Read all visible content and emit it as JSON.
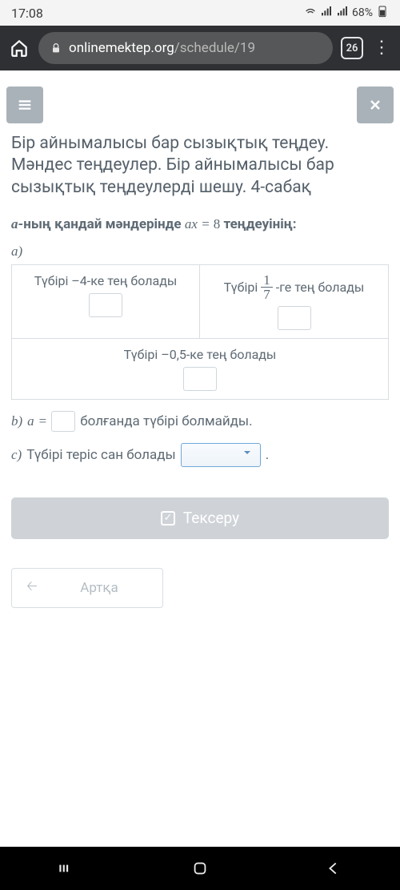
{
  "status": {
    "time": "17:08",
    "battery": "68%"
  },
  "browser": {
    "domain": "onlinemektep.org",
    "path": "/schedule/19",
    "tab_count": "26"
  },
  "lesson": {
    "title": "Бір айнымалысы бар сызықтық теңдеу. Мәндес теңдеулер. Бір айнымалысы бар сызықтық теңдеулерді шешу. 4-сабақ"
  },
  "question": {
    "prefix_italic": "a",
    "prefix_bold_rest": "-ның қандай мәндерінде",
    "equation_lhs": "ax",
    "equation_eq": "=",
    "equation_rhs": "8",
    "suffix": "теңдеуінің:"
  },
  "parts": {
    "a_label": "a)",
    "cell1": "Түбірі –4-ке тең болады",
    "cell2_pre": "Түбірі",
    "cell2_frac_num": "1",
    "cell2_frac_den": "7",
    "cell2_post": "-ге тең болады",
    "cell3": "Түбірі –0,5-ке тең болады",
    "b_label": "b)",
    "b_var": "a",
    "b_eq": "=",
    "b_text": "болғанда түбірі болмайды.",
    "c_label": "c)",
    "c_text": "Түбірі теріс сан болады",
    "c_period": "."
  },
  "buttons": {
    "check": "Тексеру",
    "back": "Артқа"
  }
}
